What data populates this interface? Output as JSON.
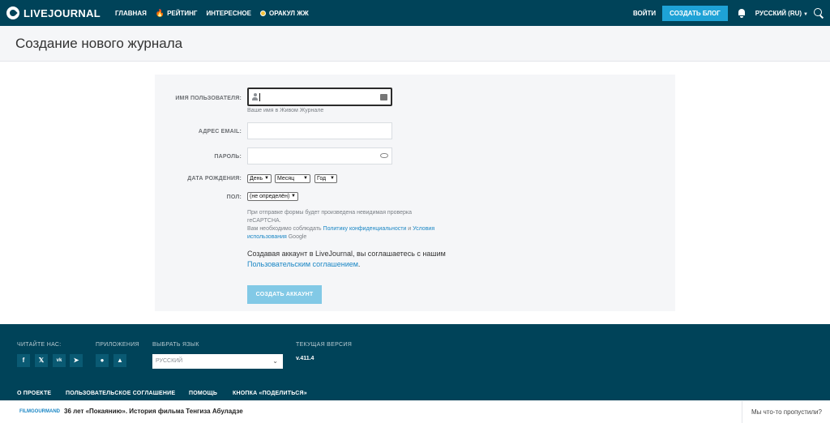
{
  "topnav": {
    "logo": "LIVEJOURNAL",
    "items": [
      "ГЛАВНАЯ",
      "РЕЙТИНГ",
      "ИНТЕРЕСНОЕ",
      "ОРАКУЛ ЖЖ"
    ],
    "login": "ВОЙТИ",
    "create_blog": "СОЗДАТЬ БЛОГ",
    "language": "РУССКИЙ (RU)"
  },
  "page": {
    "title": "Создание нового журнала"
  },
  "form": {
    "username_label": "ИМЯ ПОЛЬЗОВАТЕЛЯ:",
    "username_value": "",
    "username_hint": "Ваше имя в Живом Журнале",
    "email_label": "АДРЕС EMAIL:",
    "email_value": "",
    "password_label": "ПАРОЛЬ:",
    "password_value": "",
    "birthday_label": "ДАТА РОЖДЕНИЯ:",
    "day": "День",
    "month": "Месяц",
    "year": "Год",
    "gender_label": "ПОЛ:",
    "gender": "(не определён)",
    "recaptcha_1": "При отправке формы будет произведена невидимая проверка reCAPTCHA.",
    "recaptcha_2": "Вам необходимо соблюдать ",
    "privacy_link": "Политику конфиденциальности",
    "recaptcha_and": " и ",
    "terms_link": "Условия использования",
    "recaptcha_google": " Google",
    "agree_text": "Создавая аккаунт в LiveJournal, вы соглашаетесь с нашим ",
    "agree_link": "Пользовательским соглашением",
    "agree_end": ".",
    "submit": "СОЗДАТЬ АККАУНТ"
  },
  "footer": {
    "read_us": "ЧИТАЙТЕ НАС:",
    "apps": "ПРИЛОЖЕНИЯ",
    "choose_lang": "ВЫБРАТЬ ЯЗЫК",
    "current_version": "ТЕКУЩАЯ ВЕРСИЯ",
    "lang_value": "РУССКИЙ",
    "version": "v.411.4",
    "social": [
      "f",
      "t",
      "vk",
      "tg"
    ],
    "links": [
      "О ПРОЕКТЕ",
      "ПОЛЬЗОВАТЕЛЬСКОЕ СОГЛАШЕНИЕ",
      "ПОМОЩЬ",
      "КНОПКА «ПОДЕЛИТЬСЯ»"
    ]
  },
  "strip": {
    "source": "FILMGOURMAND",
    "title": "36 лет «Покаянию». История фильма Тенгиза Абуладзе",
    "missed": "Мы что-то пропустили?"
  },
  "colors": {
    "header_bg": "#004359",
    "accent": "#1ea2d6",
    "submit_bg": "#82c9e6"
  }
}
